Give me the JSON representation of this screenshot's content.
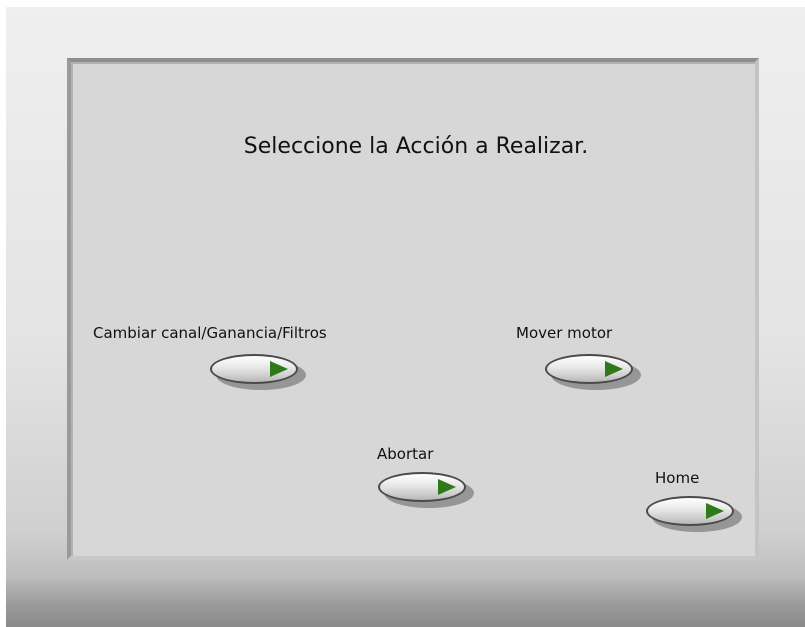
{
  "panel": {
    "title": "Seleccione la Acción a Realizar."
  },
  "buttons": {
    "cambiar_label": "Cambiar canal/Ganancia/Filtros",
    "mover_label": "Mover motor",
    "abortar_label": "Abortar",
    "home_label": "Home",
    "icon": "play-arrow-icon"
  },
  "colors": {
    "panel_bg": "#d7d7d7",
    "arrow_green": "#2f7a18"
  }
}
